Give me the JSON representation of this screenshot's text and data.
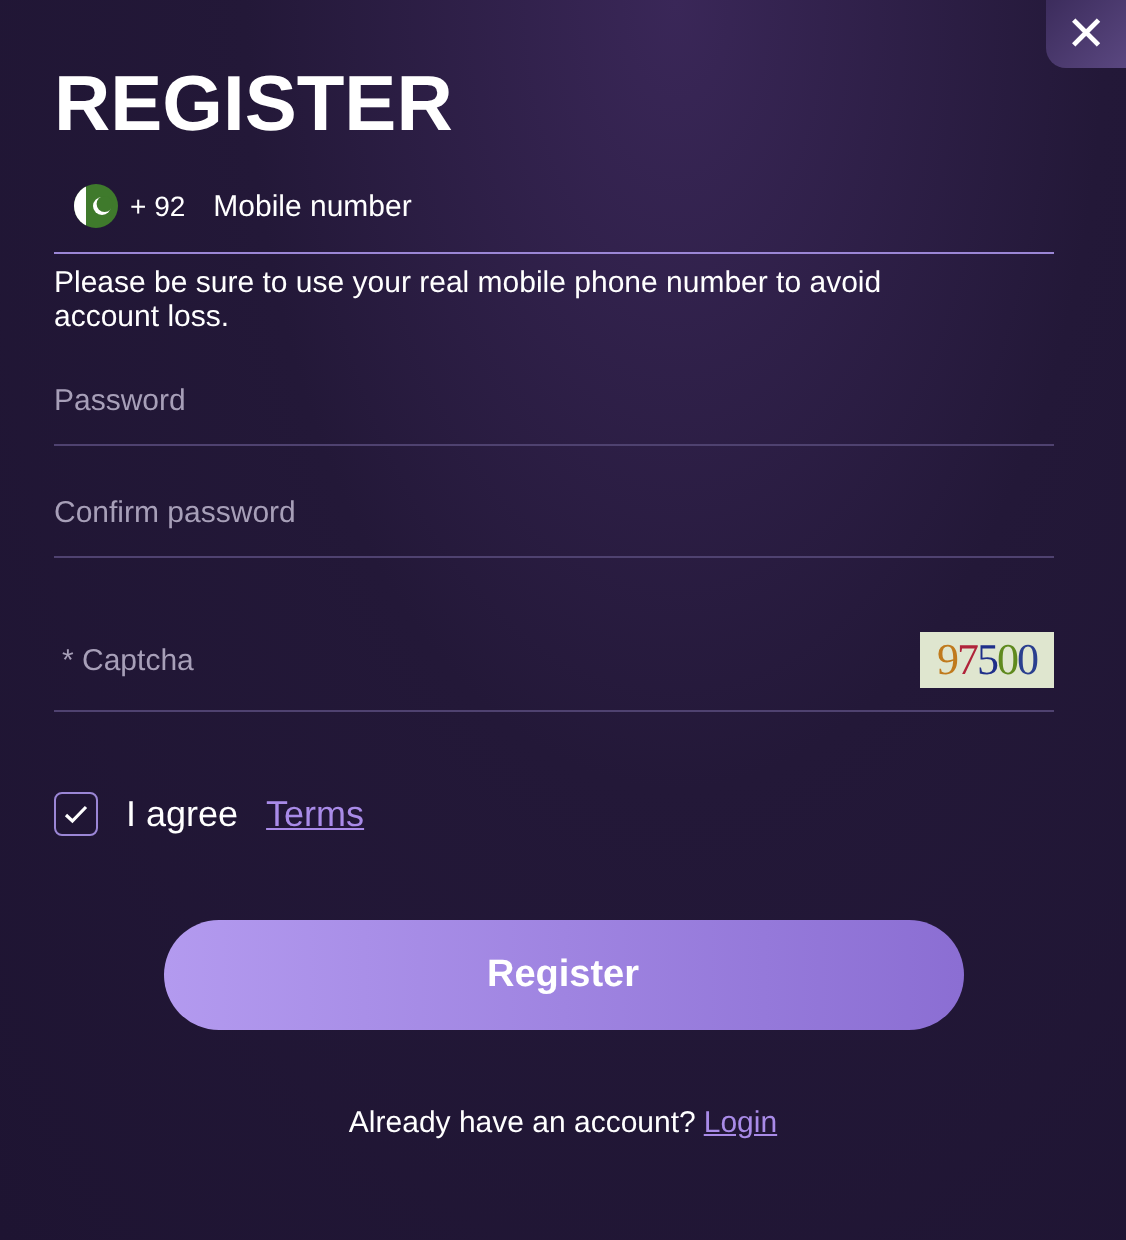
{
  "title": "REGISTER",
  "close": "✕",
  "phone": {
    "country_code": "+ 92",
    "placeholder": "Mobile number"
  },
  "phone_hint": "Please be sure to use your real mobile phone number to avoid account loss.",
  "password": {
    "placeholder": "Password"
  },
  "confirm_password": {
    "placeholder": "Confirm password"
  },
  "captcha": {
    "placeholder": "* Captcha",
    "code": "97500"
  },
  "agree": {
    "checked": true,
    "label": "I agree",
    "link": "Terms"
  },
  "submit": "Register",
  "footer": {
    "text": "Already have an account?",
    "link": "Login"
  }
}
